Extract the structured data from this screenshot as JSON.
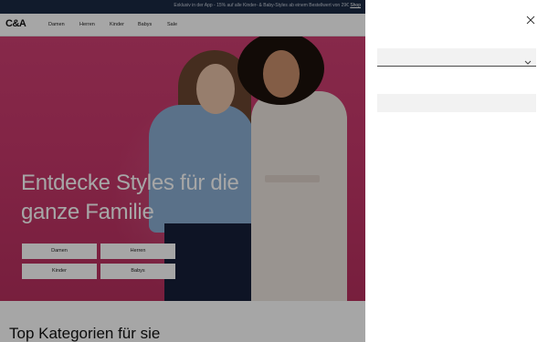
{
  "promo": {
    "text": "Exklusiv in der App - 15% auf alle Kinder- & Baby-Styles ab einem Bestellwert von 29€ ",
    "link": "Shop"
  },
  "header": {
    "logo": "C&A",
    "nav": [
      "Damen",
      "Herren",
      "Kinder",
      "Babys",
      "Sale"
    ]
  },
  "hero": {
    "headline": "Entdecke Styles für die ganze Familie",
    "buttons": [
      "Damen",
      "Herren",
      "Kinder",
      "Babys"
    ]
  },
  "section": {
    "title": "Top Kategorien für sie"
  },
  "panel": {
    "select_value": "",
    "input_value": "",
    "input_placeholder": ""
  },
  "colors": {
    "hero_bg": "#cf3f72",
    "promo_bg": "#1b2a44",
    "overlay": "rgba(0,0,0,0.35)"
  }
}
